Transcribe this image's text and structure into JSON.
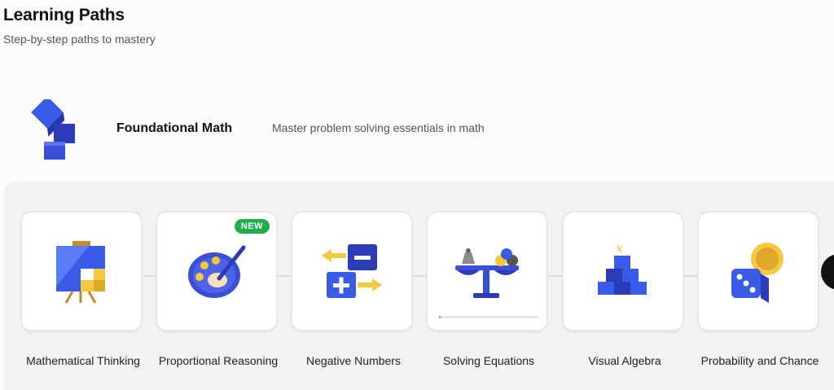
{
  "page": {
    "title": "Learning Paths",
    "subtitle": "Step-by-step paths to mastery"
  },
  "path": {
    "name": "Foundational Math",
    "description": "Master problem solving essentials in math",
    "logo_icon": "blue-cubes-icon"
  },
  "courses": [
    {
      "label": "Mathematical Thinking",
      "icon": "easel-painting-icon"
    },
    {
      "label": "Proportional Reasoning",
      "icon": "paint-palette-icon",
      "badge": "NEW"
    },
    {
      "label": "Negative Numbers",
      "icon": "plus-minus-blocks-icon"
    },
    {
      "label": "Solving Equations",
      "icon": "balance-scale-icon",
      "progress": 0.02
    },
    {
      "label": "Visual Algebra",
      "icon": "cube-pyramid-icon"
    },
    {
      "label": "Probability and Chance",
      "icon": "dice-coin-icon"
    }
  ],
  "colors": {
    "brand_blue": "#3a4fd8",
    "accent_yellow": "#f5c842",
    "badge_green": "#1fae4b"
  }
}
